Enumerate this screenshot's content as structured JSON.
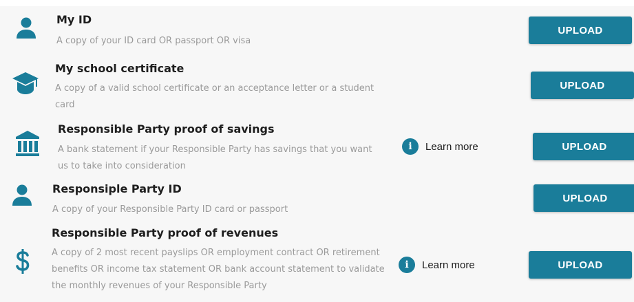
{
  "colors": {
    "accent": "#1a7d9a",
    "background": "#f7f7f7"
  },
  "documents": [
    {
      "icon": "person-icon",
      "title": "My ID",
      "description": "A copy of your ID card OR passport OR visa",
      "upload_label": "UPLOAD"
    },
    {
      "icon": "graduation-cap-icon",
      "title": "My school certificate",
      "description": "A copy of a valid school certificate or an acceptance letter or a student card",
      "upload_label": "UPLOAD"
    },
    {
      "icon": "bank-icon",
      "title": "Responsible Party proof of savings",
      "description": "A bank statement if your Responsible Party has savings that you want us to take into consideration",
      "learn_more": "Learn more",
      "upload_label": "UPLOAD"
    },
    {
      "icon": "person-icon",
      "title": "Responsiple Party ID",
      "description": "A copy of your Responsible Party ID card or passport",
      "upload_label": "UPLOAD"
    },
    {
      "icon": "dollar-icon",
      "title": "Responsible Party proof of revenues",
      "description": "A copy of 2 most recent payslips OR employment contract OR retirement benefits OR income tax statement OR bank account statement to validate the monthly revenues of your Responsible Party",
      "learn_more": "Learn more",
      "upload_label": "UPLOAD"
    }
  ]
}
